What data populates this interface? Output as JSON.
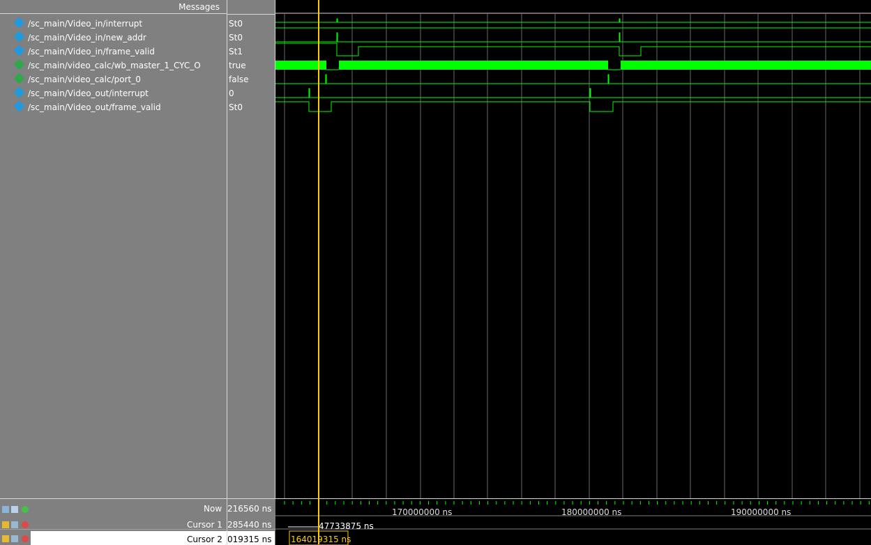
{
  "header": {
    "messages_label": "Messages"
  },
  "signals": [
    {
      "name": "/sc_main/Video_in/interrupt",
      "value": "St0",
      "icon": "diamond-blue-icon"
    },
    {
      "name": "/sc_main/Video_in/new_addr",
      "value": "St0",
      "icon": "diamond-blue-icon"
    },
    {
      "name": "/sc_main/Video_in/frame_valid",
      "value": "St1",
      "icon": "diamond-blue-icon"
    },
    {
      "name": "/sc_main/video_calc/wb_master_1_CYC_O",
      "value": "true",
      "icon": "diamond-green-icon"
    },
    {
      "name": "/sc_main/video_calc/port_0",
      "value": "false",
      "icon": "diamond-green-icon"
    },
    {
      "name": "/sc_main/Video_out/interrupt",
      "value": "0",
      "icon": "diamond-blue-icon"
    },
    {
      "name": "/sc_main/Video_out/frame_valid",
      "value": "St0",
      "icon": "diamond-blue-icon"
    }
  ],
  "bottom": {
    "now_label": "Now",
    "now_value": "216560 ns",
    "cursor1_label": "Cursor 1",
    "cursor1_value": "285440 ns",
    "cursor2_label": "Cursor 2",
    "cursor2_value": "019315 ns",
    "cursor1_delta": "47733875 ns",
    "cursor2_time": "164019315 ns"
  },
  "ruler": {
    "labels": [
      "170000000 ns",
      "180000000 ns",
      "190000000 ns"
    ]
  },
  "colors": {
    "wave": "#00ff00",
    "cursor": "#ffcc00",
    "grid": "#6a6a6a",
    "pane": "#808080"
  }
}
